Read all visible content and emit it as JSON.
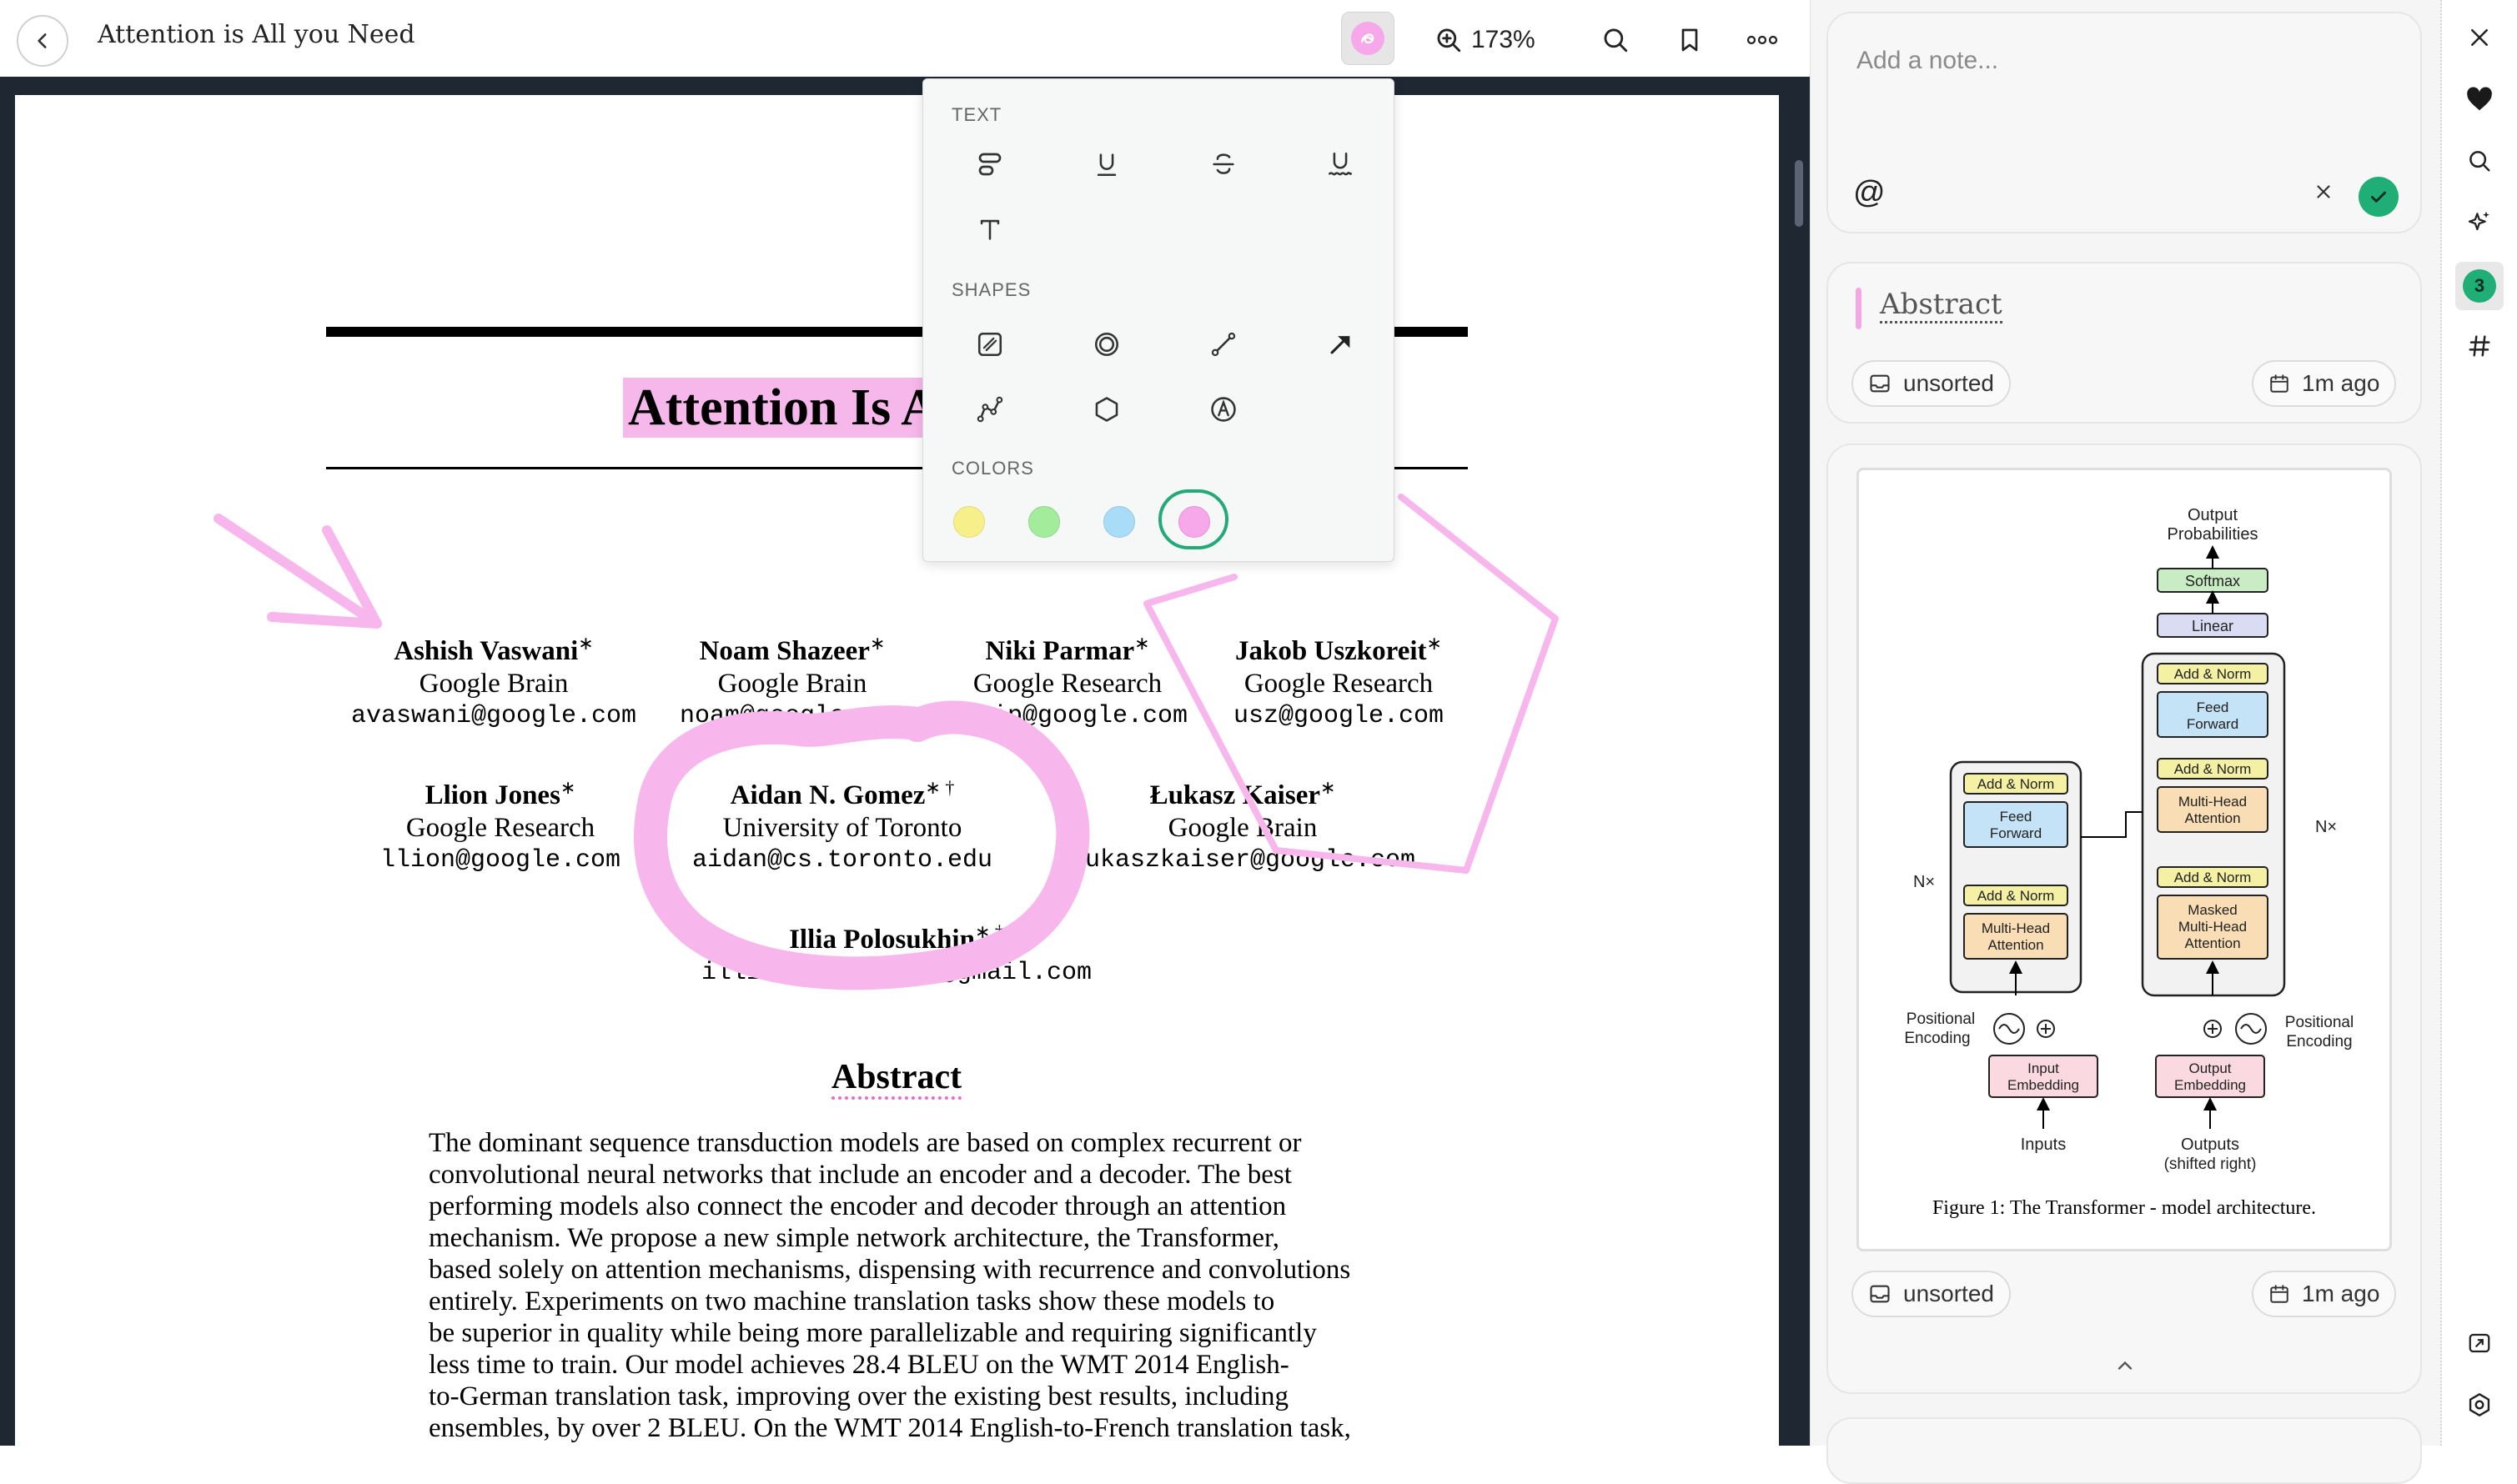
{
  "toolbar": {
    "title": "Attention is All you Need",
    "zoom": "173%",
    "back_icon": "chevron-left-icon",
    "annotate_icon": "highlighter-icon",
    "zoom_icon": "zoom-in-icon",
    "search_icon": "search-icon",
    "bookmark_icon": "bookmark-icon",
    "more_icon": "more-horizontal-icon"
  },
  "paper": {
    "title": "Attention Is All you Need",
    "authors": [
      {
        "name": "Ashish Vaswani",
        "mark": "∗",
        "affiliation": "Google Brain",
        "email": "avaswani@google.com"
      },
      {
        "name": "Noam Shazeer",
        "mark": "∗",
        "affiliation": "Google Brain",
        "email": "noam@google.com"
      },
      {
        "name": "Niki Parmar",
        "mark": "∗",
        "affiliation": "Google Research",
        "email": "nikip@google.com"
      },
      {
        "name": "Jakob Uszkoreit",
        "mark": "∗",
        "affiliation": "Google Research",
        "email": "usz@google.com"
      },
      {
        "name": "Llion Jones",
        "mark": "∗",
        "affiliation": "Google Research",
        "email": "llion@google.com"
      },
      {
        "name": "Aidan N. Gomez",
        "mark": "∗ †",
        "affiliation": "University of Toronto",
        "email": "aidan@cs.toronto.edu"
      },
      {
        "name": "Łukasz Kaiser",
        "mark": "∗",
        "affiliation": "Google Brain",
        "email": "lukaszkaiser@google.com"
      },
      {
        "name": "Illia Polosukhin",
        "mark": "∗ ‡",
        "affiliation": "",
        "email": "illia.polosukhin@gmail.com"
      }
    ],
    "abstract_heading": "Abstract",
    "abstract_lines": [
      "The dominant sequence transduction models are based on complex recurrent or",
      "convolutional neural networks that include an encoder and a decoder. The best",
      "performing models also connect the encoder and decoder through an attention",
      "mechanism. We propose a new simple network architecture, the Transformer,",
      "based solely on attention mechanisms, dispensing with recurrence and convolutions",
      "entirely. Experiments on two machine translation tasks show these models to",
      "be superior in quality while being more parallelizable and requiring significantly",
      "less time to train. Our model achieves 28.4 BLEU on the WMT 2014 English-",
      "to-German translation task, improving over the existing best results, including",
      "ensembles, by over 2 BLEU. On the WMT 2014 English-to-French translation task,"
    ]
  },
  "popup": {
    "text_label": "TEXT",
    "shapes_label": "SHAPES",
    "colors_label": "COLORS",
    "text_tools": [
      "highlight-icon",
      "underline-icon",
      "strikethrough-icon",
      "squiggly-underline-icon",
      "text-icon"
    ],
    "shape_tools": [
      "rectangle-icon",
      "ellipse-icon",
      "line-icon",
      "arrow-icon",
      "polyline-icon",
      "polygon-icon",
      "ink-signature-icon"
    ],
    "colors": [
      "#f7f08a",
      "#a2ec9c",
      "#a8dcf7",
      "#f7a8ea"
    ],
    "selected_color": "#f7a8ea",
    "ink_color": "#f7b6ec"
  },
  "notes": {
    "placeholder": "Add a note...",
    "mention_symbol": "@",
    "accent_color": "#1fae75"
  },
  "annotations": [
    {
      "title": "Abstract",
      "folder": "unsorted",
      "time": "1m ago"
    },
    {
      "folder": "unsorted",
      "time": "1m ago",
      "caption": "Figure 1: The Transformer - model architecture."
    }
  ],
  "figure": {
    "output_probabilities": "Output Probabilities",
    "softmax": "Softmax",
    "linear": "Linear",
    "add_norm": "Add & Norm",
    "feed_forward": "Feed Forward",
    "multi_head_attention": "Multi-Head Attention",
    "masked_mha": "Masked Multi-Head Attention",
    "nx": "N×",
    "positional_encoding": "Positional Encoding",
    "input_embedding": "Input Embedding",
    "output_embedding": "Output Embedding",
    "inputs": "Inputs",
    "outputs": "Outputs",
    "outputs_sub": "(shifted right)"
  },
  "rail": {
    "count": "3",
    "icons": [
      "close-icon",
      "heart-icon",
      "search-icon",
      "sparkles-icon",
      "hashtag-icon",
      "expand-icon",
      "settings-icon"
    ]
  }
}
